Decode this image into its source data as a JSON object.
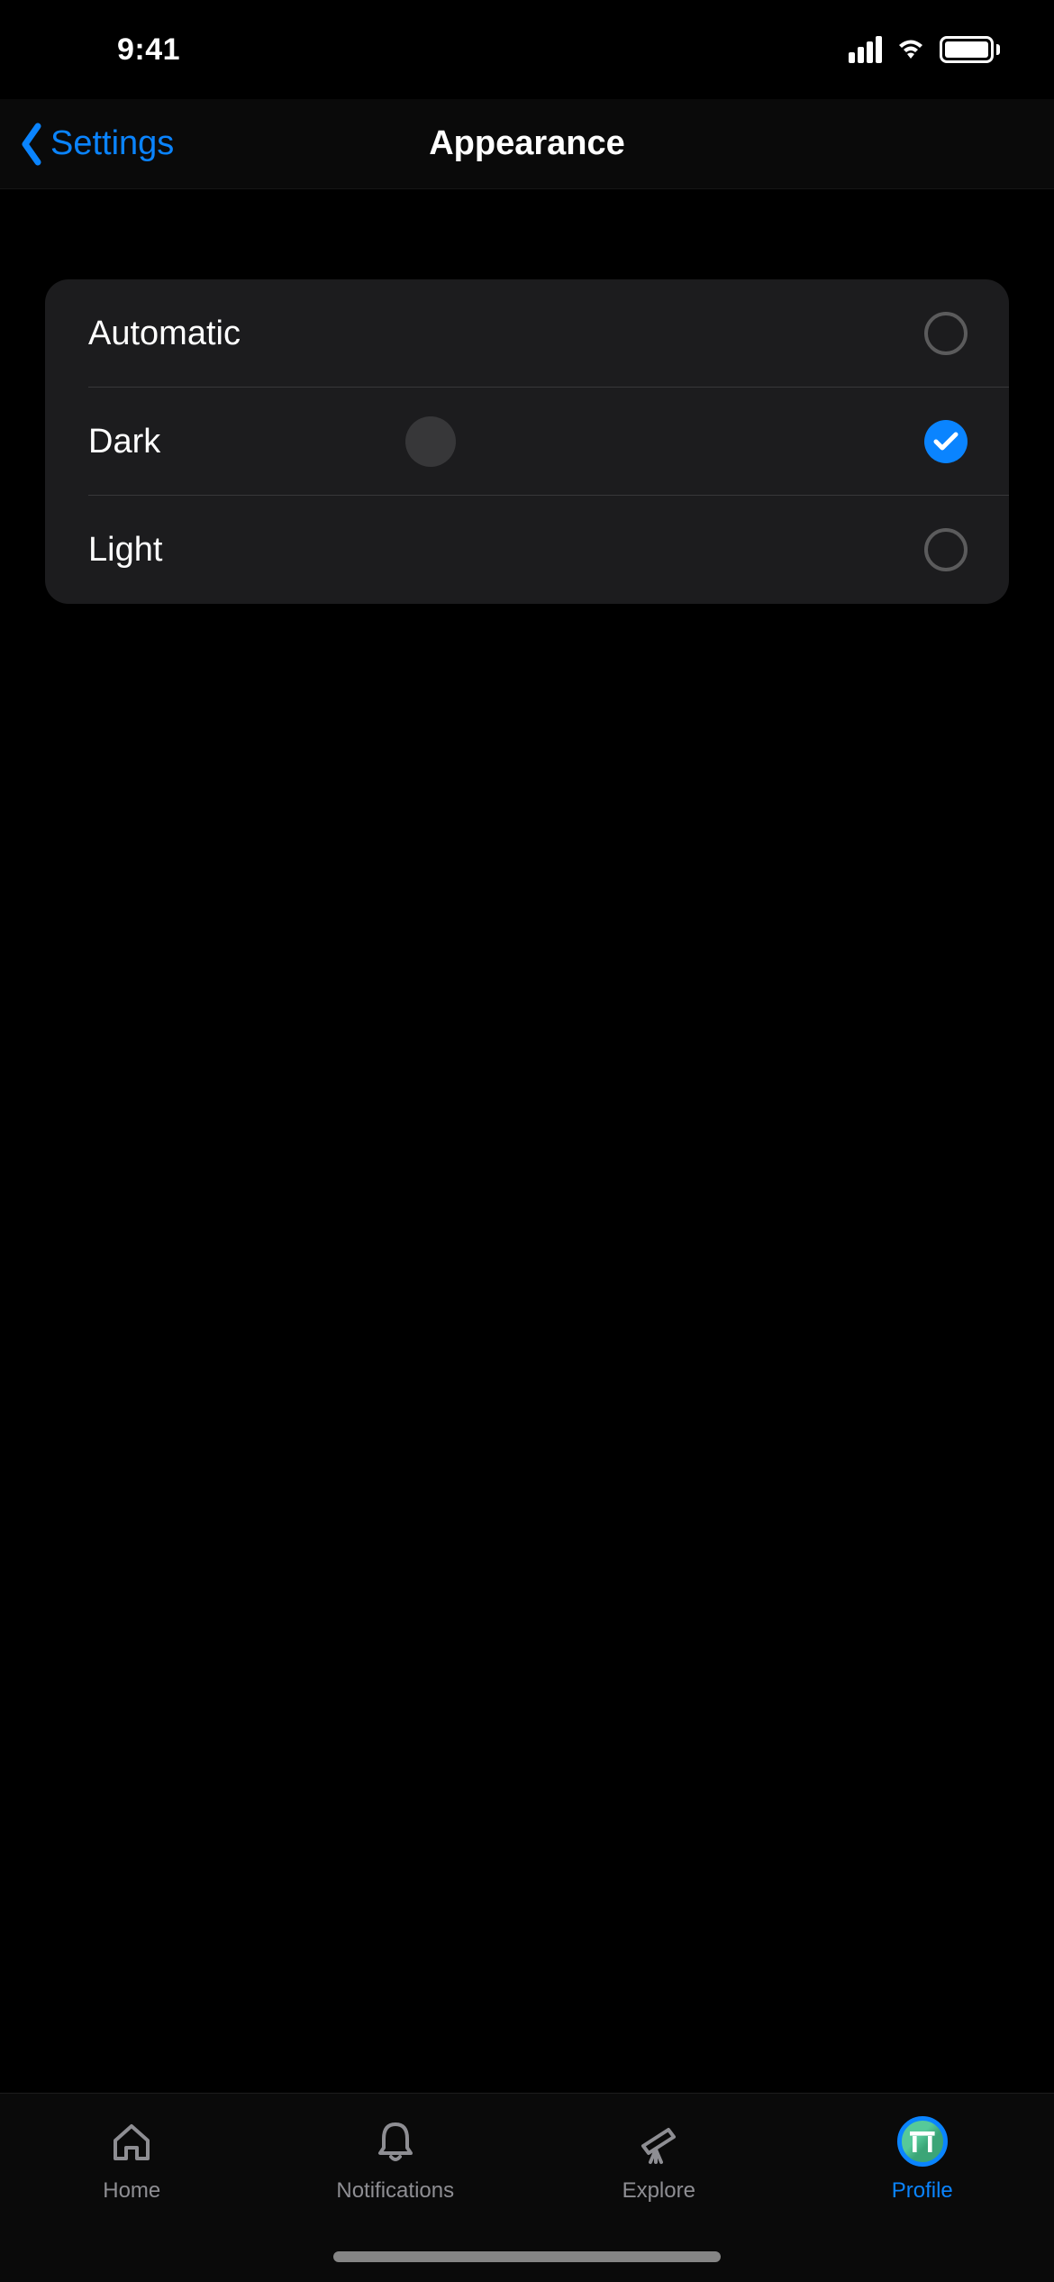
{
  "status": {
    "time": "9:41"
  },
  "nav": {
    "back_label": "Settings",
    "title": "Appearance"
  },
  "options": [
    {
      "label": "Automatic",
      "selected": false
    },
    {
      "label": "Dark",
      "selected": true
    },
    {
      "label": "Light",
      "selected": false
    }
  ],
  "tabs": [
    {
      "label": "Home",
      "icon": "home"
    },
    {
      "label": "Notifications",
      "icon": "bell"
    },
    {
      "label": "Explore",
      "icon": "telescope"
    },
    {
      "label": "Profile",
      "icon": "avatar",
      "active": true
    }
  ],
  "colors": {
    "accent": "#0a84ff",
    "inactive": "#8e8e93"
  }
}
